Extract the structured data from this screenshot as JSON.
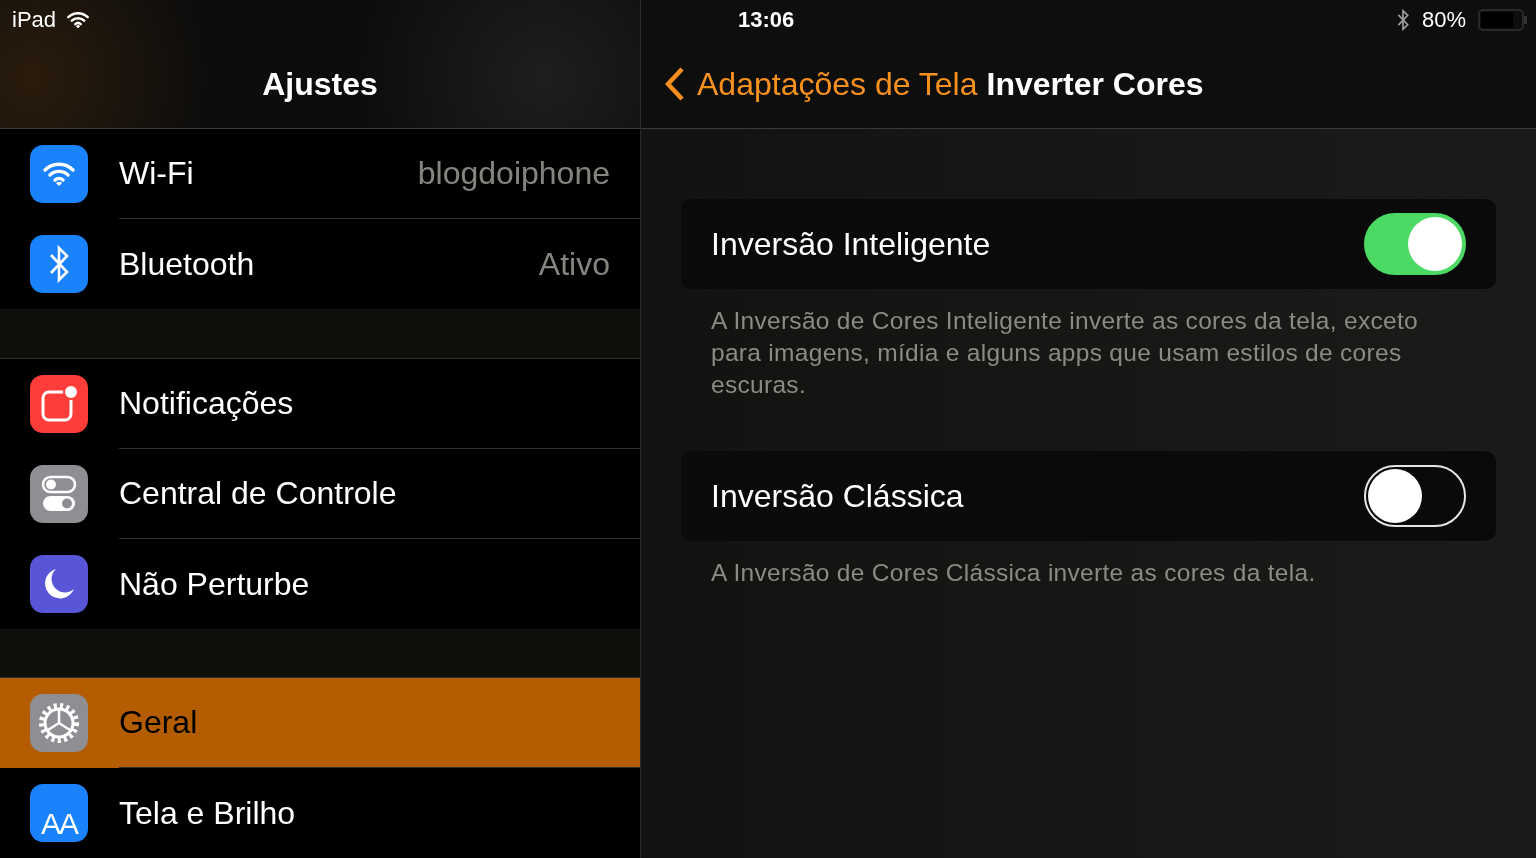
{
  "status_bar": {
    "device": "iPad",
    "time": "13:06",
    "battery": "80%"
  },
  "sidebar": {
    "title": "Ajustes",
    "groups": [
      [
        {
          "label": "Wi-Fi",
          "value": "blogdoiphone",
          "kind": "wifi",
          "color": "#1a82fb",
          "selected": false
        },
        {
          "label": "Bluetooth",
          "value": "Ativo",
          "kind": "bluetooth",
          "color": "#1a82fb",
          "selected": false
        }
      ],
      [
        {
          "label": "Notificações",
          "kind": "notifications",
          "color": "#fc3d39",
          "selected": false
        },
        {
          "label": "Central de Controle",
          "kind": "switches",
          "color": "#8e8e93",
          "selected": false
        },
        {
          "label": "Não Perturbe",
          "kind": "moon",
          "color": "#5856d6",
          "selected": false
        }
      ],
      [
        {
          "label": "Geral",
          "kind": "gear",
          "color": "#8e8e93",
          "selected": true
        },
        {
          "label": "Tela e Brilho",
          "kind": "text",
          "icon_text": "AA",
          "color": "#1a82fb",
          "selected": false
        }
      ]
    ]
  },
  "detail": {
    "back_label": "Adaptações de Tela",
    "title": "Inverter Cores",
    "sections": [
      {
        "label": "Inversão Inteligente",
        "on": true,
        "footer": "A Inversão de Cores Inteligente inverte as cores da tela, exceto para imagens, mídia e alguns apps que usam estilos de cores escuras."
      },
      {
        "label": "Inversão Clássica",
        "on": false,
        "footer": "A Inversão de Cores Clássica inverte as cores da tela."
      }
    ]
  }
}
